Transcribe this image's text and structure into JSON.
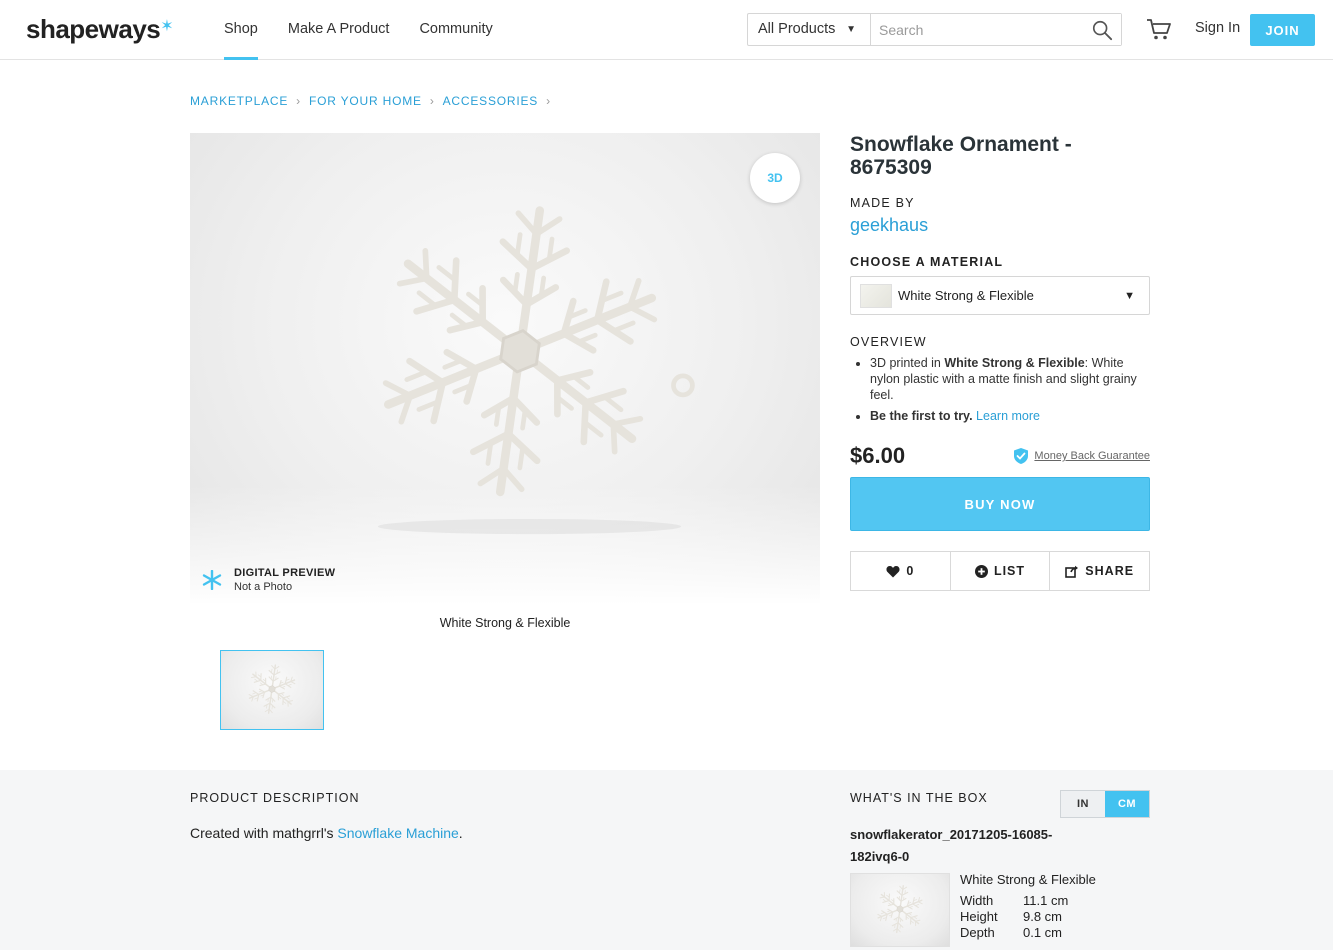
{
  "header": {
    "logo": "shapeways",
    "nav": [
      "Shop",
      "Make A Product",
      "Community"
    ],
    "category": "All Products",
    "search_placeholder": "Search",
    "signin": "Sign In",
    "join": "JOIN",
    "accent_color": "#43c2f0"
  },
  "breadcrumb": [
    "MARKETPLACE",
    "FOR YOUR HOME",
    "ACCESSORIES"
  ],
  "gallery": {
    "btn_3d": "3D",
    "preview_title": "DIGITAL PREVIEW",
    "preview_sub": "Not a Photo",
    "caption": "White Strong & Flexible"
  },
  "product": {
    "title": "Snowflake Ornament - 8675309",
    "made_by_label": "MADE BY",
    "maker": "geekhaus",
    "choose_material_label": "CHOOSE A MATERIAL",
    "material": "White Strong & Flexible",
    "overview_label": "OVERVIEW",
    "overview_1_prefix": "3D printed in ",
    "overview_1_bold": "White Strong & Flexible",
    "overview_1_rest": ": White nylon plastic with a matte finish and slight grainy feel.",
    "overview_2_bold": "Be the first to try.",
    "overview_2_link": "Learn more",
    "price": "$6.00",
    "guarantee": "Money Back Guarantee",
    "buy_now": "BUY NOW",
    "likes": "0",
    "list": "LIST",
    "share": "SHARE"
  },
  "bottom": {
    "description_label": "PRODUCT DESCRIPTION",
    "description_prefix": "Created with mathgrrl's ",
    "description_link": "Snowflake Machine",
    "description_suffix": ".",
    "box_label": "WHAT'S IN THE BOX",
    "unit_in": "IN",
    "unit_cm": "CM",
    "filename": "snowflakerator_20171205-16085-182ivq6-0",
    "box_material": "White Strong & Flexible",
    "dimensions": [
      {
        "name": "Width",
        "value": "11.1 cm"
      },
      {
        "name": "Height",
        "value": "9.8 cm"
      },
      {
        "name": "Depth",
        "value": "0.1 cm"
      }
    ]
  }
}
